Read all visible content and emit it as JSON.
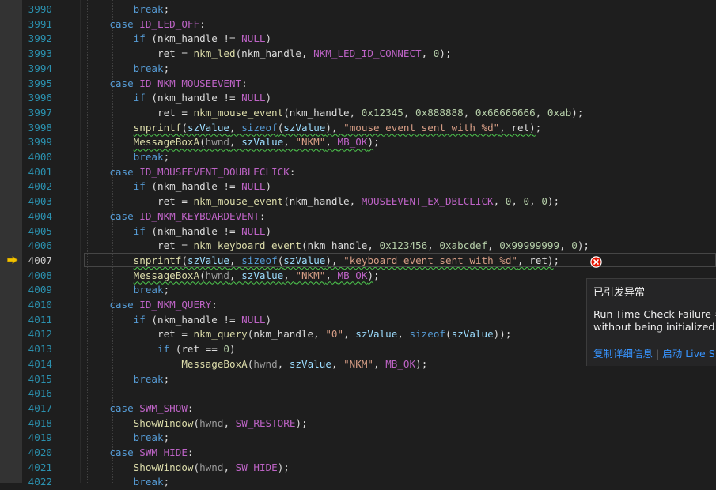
{
  "editor": {
    "current_line": "4007",
    "lines": [
      {
        "n": "3990",
        "t": [
          {
            "c": "kw",
            "v": "        break"
          },
          {
            "v": ";"
          }
        ]
      },
      {
        "n": "3991",
        "t": [
          {
            "c": "kw",
            "v": "    case "
          },
          {
            "c": "mc",
            "v": "ID_LED_OFF"
          },
          {
            "v": ":"
          }
        ]
      },
      {
        "n": "3992",
        "t": [
          {
            "c": "kw",
            "v": "        if"
          },
          {
            "v": " (nkm_handle != "
          },
          {
            "c": "mc",
            "v": "NULL"
          },
          {
            "v": ")"
          }
        ]
      },
      {
        "n": "3993",
        "t": [
          {
            "v": "            ret = "
          },
          {
            "c": "fn",
            "v": "nkm_led"
          },
          {
            "v": "(nkm_handle, "
          },
          {
            "c": "mc",
            "v": "NKM_LED_ID_CONNECT"
          },
          {
            "v": ", "
          },
          {
            "c": "nm",
            "v": "0"
          },
          {
            "v": ");"
          }
        ]
      },
      {
        "n": "3994",
        "t": [
          {
            "c": "kw",
            "v": "        break"
          },
          {
            "v": ";"
          }
        ]
      },
      {
        "n": "3995",
        "t": [
          {
            "c": "kw",
            "v": "    case "
          },
          {
            "c": "mc",
            "v": "ID_NKM_MOUSEEVENT"
          },
          {
            "v": ":"
          }
        ]
      },
      {
        "n": "3996",
        "t": [
          {
            "c": "kw",
            "v": "        if"
          },
          {
            "v": " (nkm_handle != "
          },
          {
            "c": "mc",
            "v": "NULL"
          },
          {
            "v": ")"
          }
        ]
      },
      {
        "n": "3997",
        "t": [
          {
            "v": "            ret = "
          },
          {
            "c": "fn",
            "v": "nkm_mouse_event"
          },
          {
            "v": "(nkm_handle, "
          },
          {
            "c": "nm",
            "v": "0x12345"
          },
          {
            "v": ", "
          },
          {
            "c": "nm",
            "v": "0x888888"
          },
          {
            "v": ", "
          },
          {
            "c": "nm",
            "v": "0x66666666"
          },
          {
            "v": ", "
          },
          {
            "c": "nm",
            "v": "0xab"
          },
          {
            "v": ");"
          }
        ]
      },
      {
        "n": "3998",
        "t": [
          {
            "v": "        "
          },
          {
            "c": "fn sq",
            "v": "snprintf"
          },
          {
            "c": "sq",
            "v": "("
          },
          {
            "c": "vr sq",
            "v": "szValue"
          },
          {
            "c": "sq",
            "v": ", "
          },
          {
            "c": "kw sq",
            "v": "sizeof"
          },
          {
            "c": "sq",
            "v": "("
          },
          {
            "c": "vr sq",
            "v": "szValue"
          },
          {
            "c": "sq",
            "v": "), "
          },
          {
            "c": "st sq",
            "v": "\"mouse event sent with %d\""
          },
          {
            "c": "sq",
            "v": ", ret)"
          },
          {
            "v": ";"
          }
        ]
      },
      {
        "n": "3999",
        "t": [
          {
            "v": "        "
          },
          {
            "c": "fn sq",
            "v": "MessageBoxA"
          },
          {
            "c": "sq",
            "v": "("
          },
          {
            "c": "pa sq",
            "v": "hwnd"
          },
          {
            "c": "sq",
            "v": ", "
          },
          {
            "c": "vr sq",
            "v": "szValue"
          },
          {
            "c": "sq",
            "v": ", "
          },
          {
            "c": "st sq",
            "v": "\"NKM\""
          },
          {
            "c": "sq",
            "v": ", "
          },
          {
            "c": "mc sq",
            "v": "MB_OK"
          },
          {
            "c": "sq",
            "v": ")"
          },
          {
            "v": ";"
          }
        ]
      },
      {
        "n": "4000",
        "t": [
          {
            "c": "kw",
            "v": "        break"
          },
          {
            "v": ";"
          }
        ]
      },
      {
        "n": "4001",
        "t": [
          {
            "c": "kw",
            "v": "    case "
          },
          {
            "c": "mc",
            "v": "ID_MOUSEEVENT_DOUBLECLICK"
          },
          {
            "v": ":"
          }
        ]
      },
      {
        "n": "4002",
        "t": [
          {
            "c": "kw",
            "v": "        if"
          },
          {
            "v": " (nkm_handle != "
          },
          {
            "c": "mc",
            "v": "NULL"
          },
          {
            "v": ")"
          }
        ]
      },
      {
        "n": "4003",
        "t": [
          {
            "v": "            ret = "
          },
          {
            "c": "fn",
            "v": "nkm_mouse_event"
          },
          {
            "v": "(nkm_handle, "
          },
          {
            "c": "mc",
            "v": "MOUSEEVENT_EX_DBLCLICK"
          },
          {
            "v": ", "
          },
          {
            "c": "nm",
            "v": "0"
          },
          {
            "v": ", "
          },
          {
            "c": "nm",
            "v": "0"
          },
          {
            "v": ", "
          },
          {
            "c": "nm",
            "v": "0"
          },
          {
            "v": ");"
          }
        ]
      },
      {
        "n": "4004",
        "t": [
          {
            "c": "kw",
            "v": "    case "
          },
          {
            "c": "mc",
            "v": "ID_NKM_KEYBOARDEVENT"
          },
          {
            "v": ":"
          }
        ]
      },
      {
        "n": "4005",
        "t": [
          {
            "c": "kw",
            "v": "        if"
          },
          {
            "v": " (nkm_handle != "
          },
          {
            "c": "mc",
            "v": "NULL"
          },
          {
            "v": ")"
          }
        ]
      },
      {
        "n": "4006",
        "t": [
          {
            "v": "            ret = "
          },
          {
            "c": "fn",
            "v": "nkm_keyboard_event"
          },
          {
            "v": "(nkm_handle, "
          },
          {
            "c": "nm",
            "v": "0x123456"
          },
          {
            "v": ", "
          },
          {
            "c": "nm",
            "v": "0xabcdef"
          },
          {
            "v": ", "
          },
          {
            "c": "nm",
            "v": "0x99999999"
          },
          {
            "v": ", "
          },
          {
            "c": "nm",
            "v": "0"
          },
          {
            "v": ");"
          }
        ]
      },
      {
        "n": "4007",
        "t": [
          {
            "v": "        "
          },
          {
            "c": "fn sq",
            "v": "snprintf"
          },
          {
            "c": "sq",
            "v": "("
          },
          {
            "c": "vr sq",
            "v": "szValue"
          },
          {
            "c": "sq",
            "v": ", "
          },
          {
            "c": "kw sq",
            "v": "sizeof"
          },
          {
            "c": "sq",
            "v": "("
          },
          {
            "c": "vr sq",
            "v": "szValue"
          },
          {
            "c": "sq",
            "v": "), "
          },
          {
            "c": "st sq",
            "v": "\"keyboard event sent with %d\""
          },
          {
            "c": "sq",
            "v": ", ret)"
          },
          {
            "v": ";"
          }
        ]
      },
      {
        "n": "4008",
        "t": [
          {
            "v": "        "
          },
          {
            "c": "fn sq",
            "v": "MessageBoxA"
          },
          {
            "c": "sq",
            "v": "("
          },
          {
            "c": "pa sq",
            "v": "hwnd"
          },
          {
            "c": "sq",
            "v": ", "
          },
          {
            "c": "vr sq",
            "v": "szValue"
          },
          {
            "c": "sq",
            "v": ", "
          },
          {
            "c": "st sq",
            "v": "\"NKM\""
          },
          {
            "c": "sq",
            "v": ", "
          },
          {
            "c": "mc sq",
            "v": "MB_OK"
          },
          {
            "c": "sq",
            "v": ")"
          },
          {
            "v": ";"
          }
        ]
      },
      {
        "n": "4009",
        "t": [
          {
            "c": "kw",
            "v": "        break"
          },
          {
            "v": ";"
          }
        ]
      },
      {
        "n": "4010",
        "t": [
          {
            "c": "kw",
            "v": "    case "
          },
          {
            "c": "mc",
            "v": "ID_NKM_QUERY"
          },
          {
            "v": ":"
          }
        ]
      },
      {
        "n": "4011",
        "t": [
          {
            "c": "kw",
            "v": "        if"
          },
          {
            "v": " (nkm_handle != "
          },
          {
            "c": "mc",
            "v": "NULL"
          },
          {
            "v": ")"
          }
        ]
      },
      {
        "n": "4012",
        "t": [
          {
            "v": "            ret = "
          },
          {
            "c": "fn",
            "v": "nkm_query"
          },
          {
            "v": "(nkm_handle, "
          },
          {
            "c": "st",
            "v": "\"0\""
          },
          {
            "v": ", "
          },
          {
            "c": "vr",
            "v": "szValue"
          },
          {
            "v": ", "
          },
          {
            "c": "kw",
            "v": "sizeof"
          },
          {
            "v": "("
          },
          {
            "c": "vr",
            "v": "szValue"
          },
          {
            "v": "));"
          }
        ]
      },
      {
        "n": "4013",
        "t": [
          {
            "c": "kw",
            "v": "            if"
          },
          {
            "v": " (ret == "
          },
          {
            "c": "nm",
            "v": "0"
          },
          {
            "v": ")"
          }
        ]
      },
      {
        "n": "4014",
        "t": [
          {
            "v": "                "
          },
          {
            "c": "fn",
            "v": "MessageBoxA"
          },
          {
            "v": "("
          },
          {
            "c": "pa",
            "v": "hwnd"
          },
          {
            "v": ", "
          },
          {
            "c": "vr",
            "v": "szValue"
          },
          {
            "v": ", "
          },
          {
            "c": "st",
            "v": "\"NKM\""
          },
          {
            "v": ", "
          },
          {
            "c": "mc",
            "v": "MB_OK"
          },
          {
            "v": ");"
          }
        ]
      },
      {
        "n": "4015",
        "t": [
          {
            "c": "kw",
            "v": "        break"
          },
          {
            "v": ";"
          }
        ]
      },
      {
        "n": "4016",
        "t": []
      },
      {
        "n": "4017",
        "t": [
          {
            "c": "kw",
            "v": "    case "
          },
          {
            "c": "mc",
            "v": "SWM_SHOW"
          },
          {
            "v": ":"
          }
        ]
      },
      {
        "n": "4018",
        "t": [
          {
            "v": "        "
          },
          {
            "c": "fn",
            "v": "ShowWindow"
          },
          {
            "v": "("
          },
          {
            "c": "pa",
            "v": "hwnd"
          },
          {
            "v": ", "
          },
          {
            "c": "mc",
            "v": "SW_RESTORE"
          },
          {
            "v": ");"
          }
        ]
      },
      {
        "n": "4019",
        "t": [
          {
            "c": "kw",
            "v": "        break"
          },
          {
            "v": ";"
          }
        ]
      },
      {
        "n": "4020",
        "t": [
          {
            "c": "kw",
            "v": "    case "
          },
          {
            "c": "mc",
            "v": "SWM_HIDE"
          },
          {
            "v": ":"
          }
        ]
      },
      {
        "n": "4021",
        "t": [
          {
            "v": "        "
          },
          {
            "c": "fn",
            "v": "ShowWindow"
          },
          {
            "v": "("
          },
          {
            "c": "pa",
            "v": "hwnd"
          },
          {
            "v": ", "
          },
          {
            "c": "mc",
            "v": "SW_HIDE"
          },
          {
            "v": ");"
          }
        ]
      },
      {
        "n": "4022",
        "t": [
          {
            "c": "kw",
            "v": "        break"
          },
          {
            "v": ";"
          }
        ]
      }
    ]
  },
  "exception_popup": {
    "title": "已引发异常",
    "message_line1": "Run-Time Check Failure #",
    "message_line2": "without being initialized.",
    "link_copy_details": "复制详细信息",
    "link_start_live": "启动 Live S"
  },
  "icons": {
    "current_statement": "current-statement-arrow-icon",
    "exception": "exception-error-icon"
  },
  "colors": {
    "background": "#1e1e1e",
    "line_number": "#2b91af",
    "keyword": "#569cd6",
    "function": "#dcdcaa",
    "macro": "#bd63c5",
    "number": "#b5cea8",
    "string": "#d69d85",
    "error_red": "#e51400",
    "link": "#3794ff",
    "arrow": "#f2c200"
  }
}
